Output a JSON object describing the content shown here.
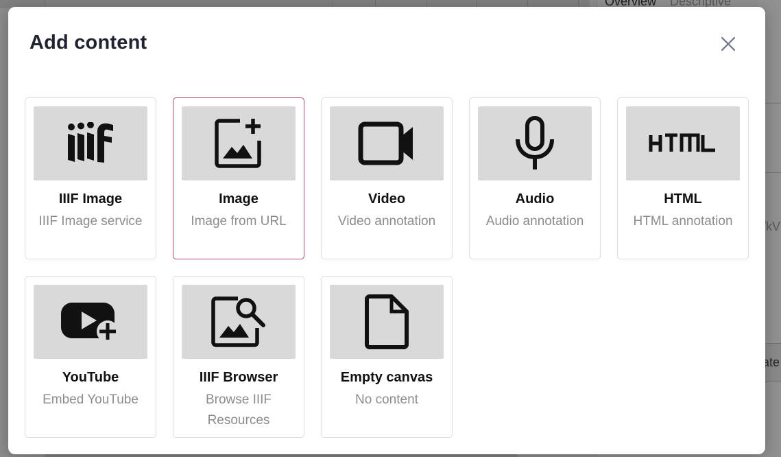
{
  "background": {
    "tabs": [
      "Overview",
      "Descriptive"
    ],
    "fragments": [
      "/kV",
      "ate"
    ]
  },
  "modal": {
    "title": "Add content",
    "close_icon": "close-icon"
  },
  "colors": {
    "selected_border": "#b0457a",
    "thumb_bg": "#d9d9d9",
    "desc_text": "#8c8c8c"
  },
  "cards": [
    {
      "title": "IIIF Image",
      "desc": "IIIF Image service",
      "icon": "iiif-logo-icon",
      "selected": false
    },
    {
      "title": "Image",
      "desc": "Image from URL",
      "icon": "image-add-icon",
      "selected": true
    },
    {
      "title": "Video",
      "desc": "Video annotation",
      "icon": "video-camera-icon",
      "selected": false
    },
    {
      "title": "Audio",
      "desc": "Audio annotation",
      "icon": "microphone-icon",
      "selected": false
    },
    {
      "title": "HTML",
      "desc": "HTML annotation",
      "icon": "html-icon",
      "selected": false
    },
    {
      "title": "YouTube",
      "desc": "Embed YouTube",
      "icon": "youtube-add-icon",
      "selected": false
    },
    {
      "title": "IIIF Browser",
      "desc": "Browse IIIF Resources",
      "icon": "image-search-icon",
      "selected": false
    },
    {
      "title": "Empty canvas",
      "desc": "No content",
      "icon": "blank-document-icon",
      "selected": false
    }
  ]
}
